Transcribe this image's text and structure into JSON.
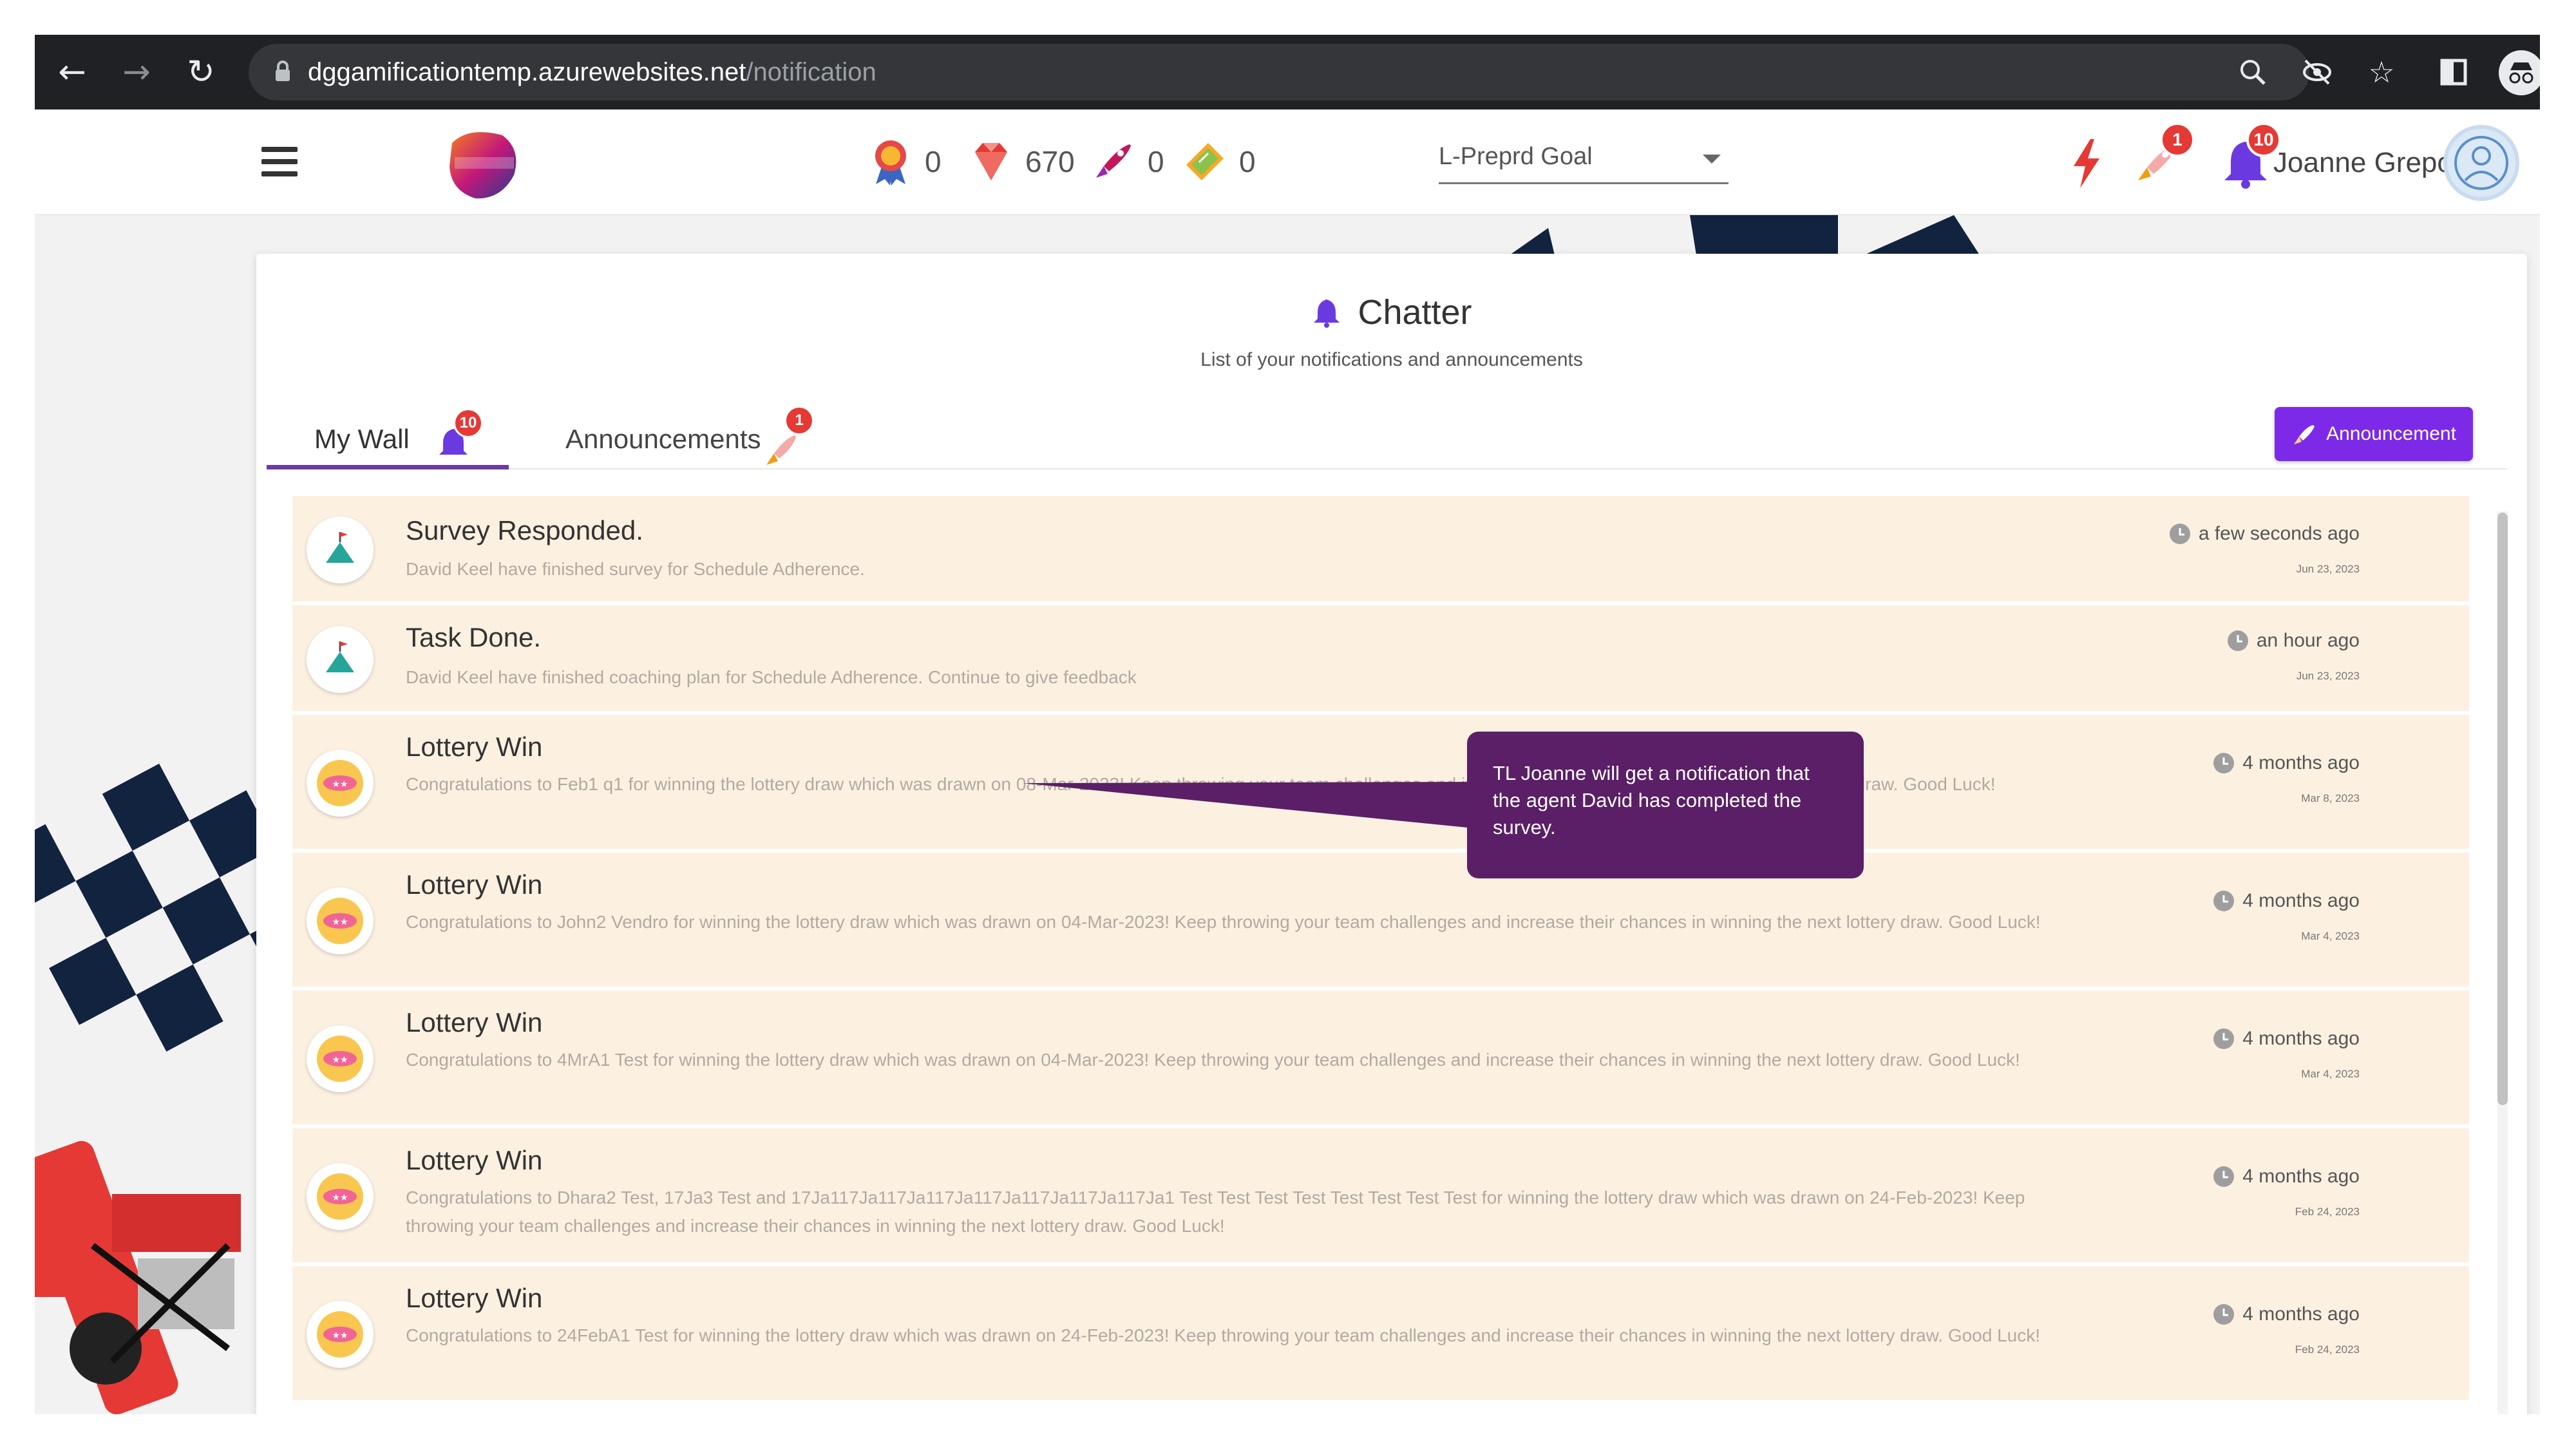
{
  "browser": {
    "url_domain": "dggamificationtemp.azurewebsites.net",
    "url_path": "/notification",
    "back_icon": "arrow-left-icon",
    "forward_icon": "arrow-right-icon",
    "reload_icon": "reload-icon"
  },
  "header": {
    "stats": [
      {
        "icon": "medal-icon",
        "value": "0"
      },
      {
        "icon": "gem-icon",
        "value": "670"
      },
      {
        "icon": "rocket-icon",
        "value": "0"
      },
      {
        "icon": "ticket-icon",
        "value": "0"
      }
    ],
    "goal_select": "L-Preprd Goal",
    "rocket_badge": "1",
    "bell_badge": "10",
    "user_name": "Joanne Grepo"
  },
  "chatter": {
    "title": "Chatter",
    "subtitle": "List of your notifications and announcements",
    "tabs": [
      {
        "label": "My Wall",
        "badge": "10"
      },
      {
        "label": "Announcements",
        "badge": "1"
      }
    ],
    "announcement_button": "Announcement"
  },
  "notifications": [
    {
      "title": "Survey Responded.",
      "body": "David Keel have finished survey for Schedule Adherence.",
      "time": "a few seconds ago",
      "date": "Jun 23, 2023"
    },
    {
      "title": "Task Done.",
      "body": "David Keel have finished coaching plan for Schedule Adherence. Continue to give feedback",
      "time": "an hour ago",
      "date": "Jun 23, 2023"
    },
    {
      "title": "Lottery Win",
      "body": "Congratulations to Feb1 q1 for winning the lottery draw which was drawn on 08-Mar-2023! Keep throwing your team challenges and increase their chances in winning the next lottery draw. Good Luck!",
      "time": "4 months ago",
      "date": "Mar 8, 2023"
    },
    {
      "title": "Lottery Win",
      "body": "Congratulations to John2 Vendro for winning the lottery draw which was drawn on 04-Mar-2023! Keep throwing your team challenges and increase their chances in winning the next lottery draw. Good Luck!",
      "time": "4 months ago",
      "date": "Mar 4, 2023"
    },
    {
      "title": "Lottery Win",
      "body": "Congratulations to 4MrA1 Test for winning the lottery draw which was drawn on 04-Mar-2023! Keep throwing your team challenges and increase their chances in winning the next lottery draw. Good Luck!",
      "time": "4 months ago",
      "date": "Mar 4, 2023"
    },
    {
      "title": "Lottery Win",
      "body": "Congratulations to Dhara2 Test, 17Ja3 Test and 17Ja117Ja117Ja117Ja117Ja117Ja117Ja117Ja1 Test Test Test Test Test Test Test Test for winning the lottery draw which was drawn on 24-Feb-2023! Keep throwing your team challenges and increase their chances in winning the next lottery draw. Good Luck!",
      "time": "4 months ago",
      "date": "Feb 24, 2023"
    },
    {
      "title": "Lottery Win",
      "body": "Congratulations to 24FebA1 Test for winning the lottery draw which was drawn on 24-Feb-2023! Keep throwing your team challenges and increase their chances in winning the next lottery draw. Good Luck!",
      "time": "4 months ago",
      "date": "Feb 24, 2023"
    }
  ],
  "callout": {
    "text": "TL Joanne will get a notification that the agent  David has completed the survey."
  },
  "colors": {
    "accent_purple": "#7c2ae8",
    "tab_underline": "#6a3aa8",
    "notification_bg": "#fcf1e1",
    "badge_red": "#e53935",
    "callout_bg": "#5a1f66"
  }
}
